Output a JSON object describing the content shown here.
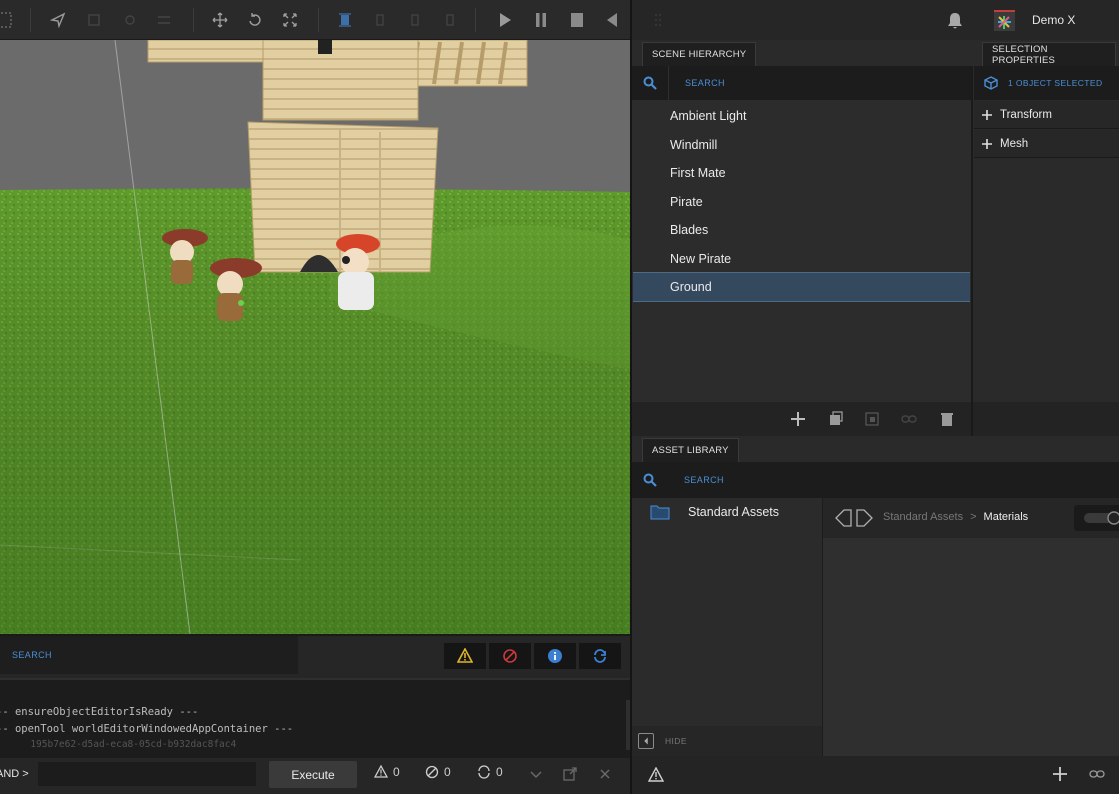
{
  "topbar": {
    "account_name": "Demo X"
  },
  "toolbar": {
    "icons": [
      "grid-icon",
      "navigate-icon",
      "move-icon",
      "rotate-icon",
      "scale-icon",
      "play-icon",
      "pause-icon",
      "stop-icon",
      "back-icon"
    ]
  },
  "hierarchy": {
    "tab": "SCENE HIERARCHY",
    "search_placeholder": "SEARCH",
    "items": [
      "Ambient Light",
      "Windmill",
      "First Mate",
      "Pirate",
      "Blades",
      "New Pirate",
      "Ground"
    ],
    "selected": "Ground"
  },
  "properties": {
    "tab": "SELECTION PROPERTIES",
    "status": "1 OBJECT SELECTED",
    "sections": [
      "Transform",
      "Mesh"
    ]
  },
  "assets": {
    "tab": "ASSET LIBRARY",
    "search_placeholder": "SEARCH",
    "folders": [
      "Standard Assets"
    ],
    "breadcrumb_root": "Standard Assets",
    "breadcrumb_sep": ">",
    "breadcrumb_current": "Materials",
    "hide_label": "HIDE"
  },
  "console": {
    "search_placeholder": "SEARCH",
    "lines": [
      "-- ensureObjectEditorIsReady ---",
      "-- openTool worldEditorWindowedAppContainer ---",
      "      195b7e62-d5ad-eca8-05cd-b932dac8fac4"
    ],
    "command_prefix": "AND >",
    "command_value": "",
    "execute_label": "Execute",
    "warnings": "0",
    "errors": "0",
    "info": "0"
  },
  "colors": {
    "accent_blue": "#4a8fd6",
    "selection_bg": "#34495e",
    "warning_yellow": "#e0b52a",
    "error_red": "#c93a3a",
    "grass_green": "#5f9a2b",
    "sky_gray": "#6b6b6b"
  }
}
